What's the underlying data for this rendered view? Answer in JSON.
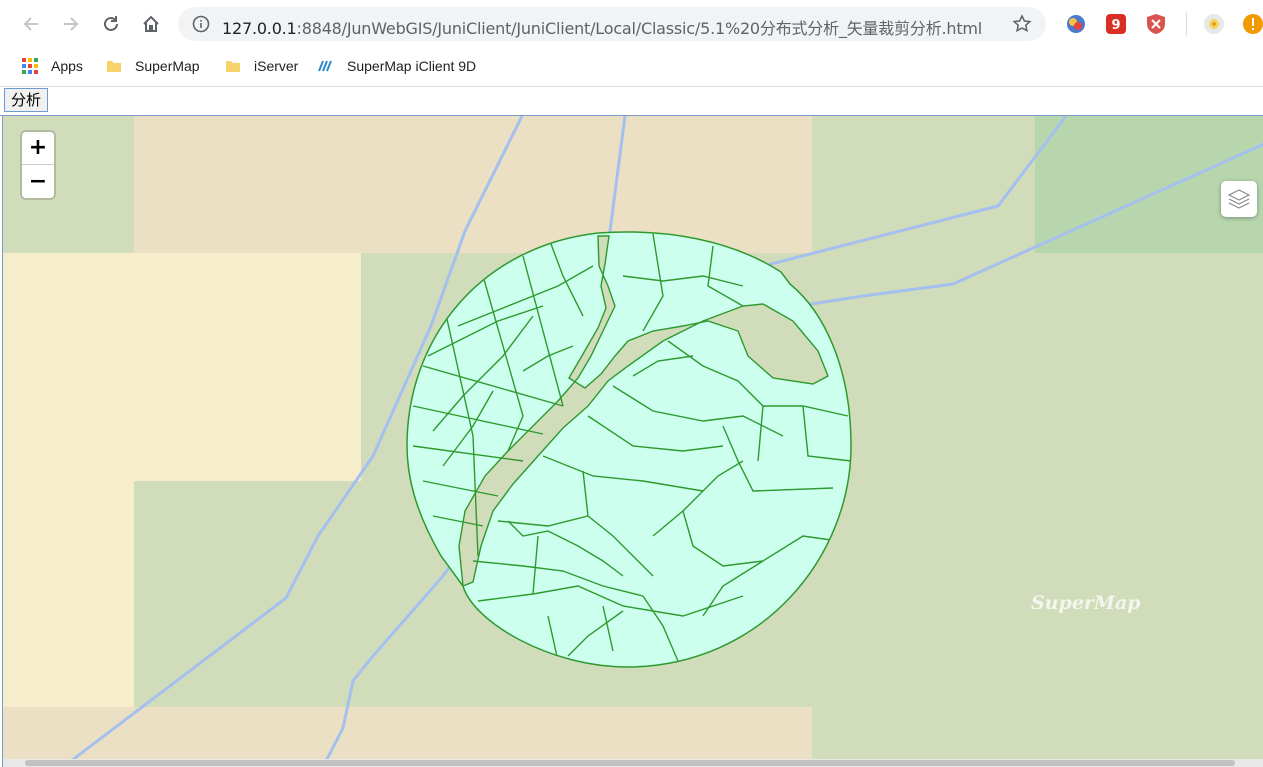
{
  "browser": {
    "url_host": "127.0.0.1",
    "url_rest": ":8848/JunWebGIS/JuniClient/JuniClient/Local/Classic/5.1%20分布式分析_矢量裁剪分析.html",
    "icons": [
      "back-icon",
      "forward-icon",
      "reload-icon",
      "home-icon",
      "info-icon",
      "star-icon"
    ]
  },
  "bookmarks": [
    {
      "label": "Apps",
      "icon": "apps-grid-icon"
    },
    {
      "label": "SuperMap",
      "icon": "folder-icon"
    },
    {
      "label": "iServer",
      "icon": "folder-icon"
    },
    {
      "label": "SuperMap iClient 9D",
      "icon": "supermap-logo-icon"
    }
  ],
  "page": {
    "analyze_button": "分析"
  },
  "map": {
    "zoom_in": "+",
    "zoom_out": "−",
    "watermark": "SuperMap",
    "colors": {
      "clip_fill": "#ccffee",
      "clip_stroke": "#2e9a2e",
      "road": "#a4c0ef",
      "base_green": "#d1dcbb",
      "base_tan": "#ebe0c3",
      "base_cream": "#f5edcb",
      "base_dark_green": "#b8d6ae"
    }
  }
}
